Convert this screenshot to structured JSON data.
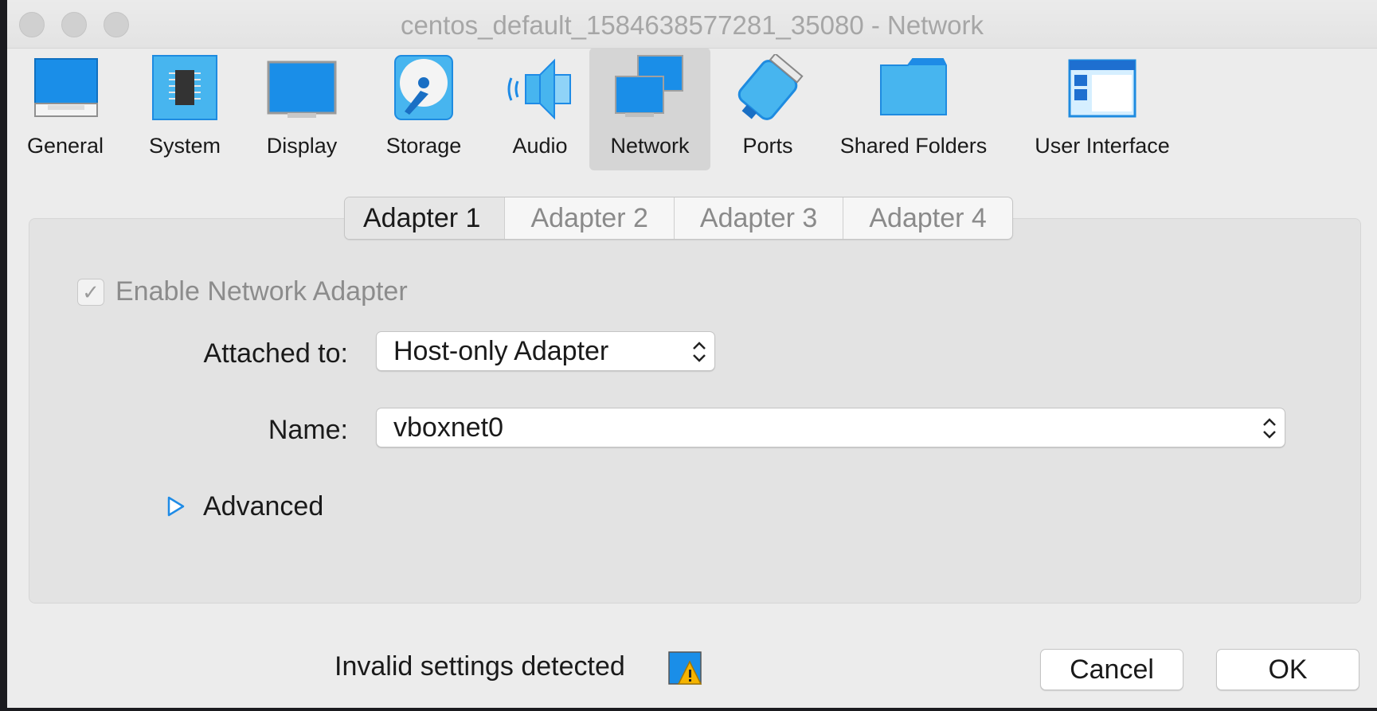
{
  "window": {
    "title": "centos_default_1584638577281_35080 - Network"
  },
  "toolbar": {
    "items": [
      {
        "label": "General",
        "icon": "general-icon"
      },
      {
        "label": "System",
        "icon": "chip-icon"
      },
      {
        "label": "Display",
        "icon": "monitor-icon"
      },
      {
        "label": "Storage",
        "icon": "disk-icon"
      },
      {
        "label": "Audio",
        "icon": "speaker-icon"
      },
      {
        "label": "Network",
        "icon": "network-icon",
        "selected": true
      },
      {
        "label": "Ports",
        "icon": "ports-icon"
      },
      {
        "label": "Shared Folders",
        "icon": "folder-icon"
      },
      {
        "label": "User Interface",
        "icon": "ui-window-icon"
      }
    ]
  },
  "tabs": [
    "Adapter 1",
    "Adapter 2",
    "Adapter 3",
    "Adapter 4"
  ],
  "active_tab": "Adapter 1",
  "form": {
    "enable_label": "Enable Network Adapter",
    "enable_checked": true,
    "enable_mark": "✓",
    "attached_label": "Attached to:",
    "attached_value": "Host-only Adapter",
    "name_label": "Name:",
    "name_value": "vboxnet0",
    "advanced_label": "Advanced"
  },
  "footer": {
    "invalid_label": "Invalid settings detected",
    "cancel_label": "Cancel",
    "ok_label": "OK"
  },
  "colors": {
    "accent": "#1e8be6",
    "warning": "#f5b400"
  }
}
